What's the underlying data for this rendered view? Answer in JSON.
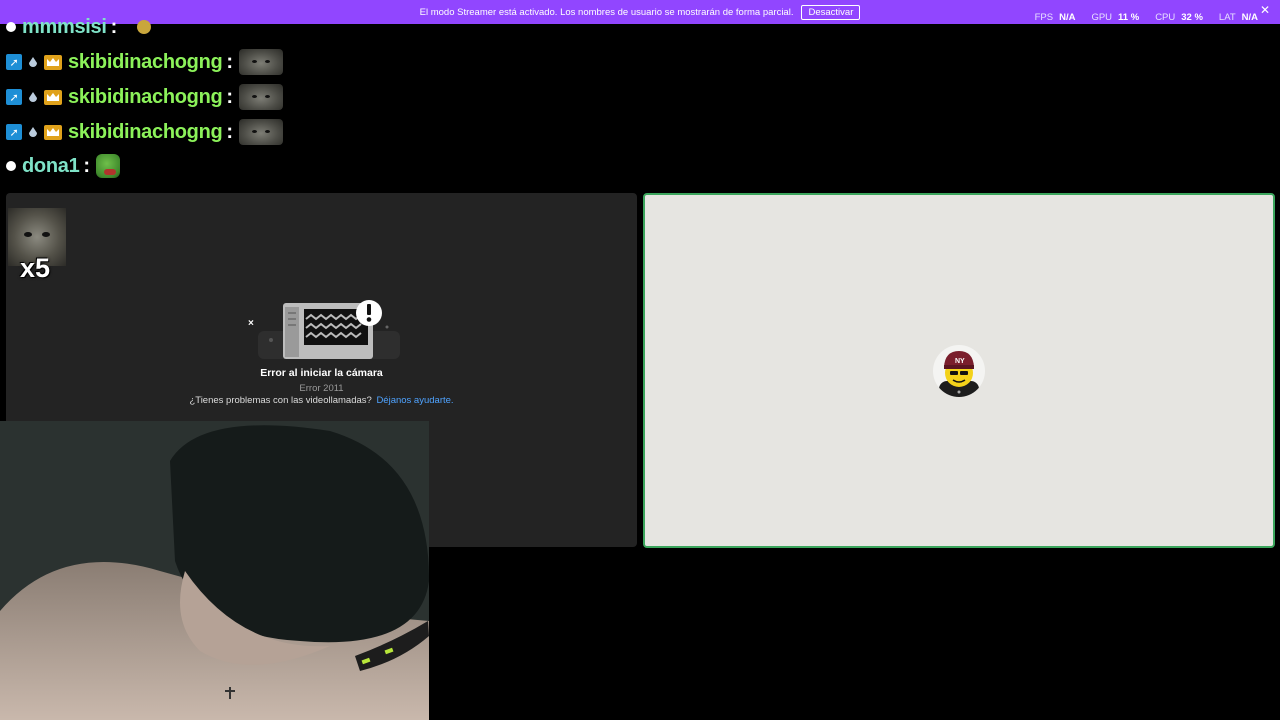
{
  "banner": {
    "message": "El modo Streamer está activado. Los nombres de usuario se mostrarán de forma parcial.",
    "button_label": "Desactivar",
    "color": "#9146ff"
  },
  "stats": {
    "fps_label": "FPS",
    "fps_value": "N/A",
    "gpu_label": "GPU",
    "gpu_value": "11 %",
    "cpu_label": "CPU",
    "cpu_value": "32 %",
    "lat_label": "LAT",
    "lat_value": "N/A"
  },
  "chat": {
    "messages": [
      {
        "user": "mmmsisi",
        "colon": ":",
        "emote": "small-emote"
      },
      {
        "user": "skibidinachogng",
        "colon": ":",
        "emote": "cat-emote"
      },
      {
        "user": "skibidinachogng",
        "colon": ":",
        "emote": "cat-emote"
      },
      {
        "user": "skibidinachogng",
        "colon": ":",
        "emote": "cat-emote"
      },
      {
        "user": "dona1",
        "colon": ":",
        "emote": "pepe-emote"
      }
    ]
  },
  "call": {
    "multiplier": "x5",
    "error_title": "Error al iniciar la cámara",
    "error_code": "Error 2011",
    "help_text": "¿Tienes problemas con las videollamadas?",
    "help_link": "Déjanos ayudarte.",
    "speaking_border_color": "#3ba55c"
  }
}
